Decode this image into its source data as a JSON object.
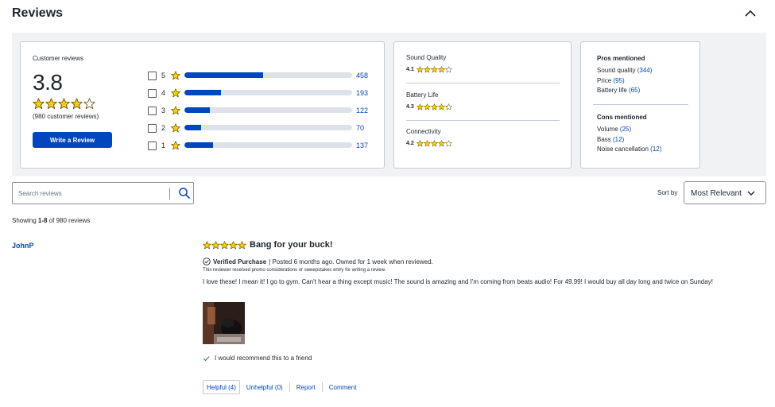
{
  "header": {
    "title": "Reviews",
    "collapse_icon": "chevron-up-icon"
  },
  "summary": {
    "label": "Customer reviews",
    "average": "3.8",
    "average_rating": 3.8,
    "count_text": "(980 customer reviews)",
    "write_button": "Write a Review",
    "histogram": [
      {
        "stars": "5",
        "count": "458",
        "fraction": 0.47
      },
      {
        "stars": "4",
        "count": "193",
        "fraction": 0.22
      },
      {
        "stars": "3",
        "count": "122",
        "fraction": 0.15
      },
      {
        "stars": "2",
        "count": "70",
        "fraction": 0.1
      },
      {
        "stars": "1",
        "count": "137",
        "fraction": 0.17
      }
    ]
  },
  "attributes": [
    {
      "name": "Sound Quality",
      "score": "4.1",
      "rating": 4.1
    },
    {
      "name": "Battery Life",
      "score": "4.3",
      "rating": 4.3
    },
    {
      "name": "Connectivity",
      "score": "4.2",
      "rating": 4.2
    }
  ],
  "pros": {
    "title": "Pros mentioned",
    "items": [
      {
        "label": "Sound quality",
        "count": "(344)"
      },
      {
        "label": "Price",
        "count": "(95)"
      },
      {
        "label": "Battery life",
        "count": "(65)"
      }
    ]
  },
  "cons": {
    "title": "Cons mentioned",
    "items": [
      {
        "label": "Volume",
        "count": "(25)"
      },
      {
        "label": "Bass",
        "count": "(12)"
      },
      {
        "label": "Noise cancellation",
        "count": "(12)"
      }
    ]
  },
  "search": {
    "placeholder": "Search reviews",
    "value": "",
    "icon": "search-icon"
  },
  "sort": {
    "label": "Sort by",
    "value": "Most Relevant"
  },
  "showing": {
    "prefix": "Showing ",
    "range": "1-8",
    "suffix": " of 980 reviews"
  },
  "review": {
    "author": "JohnP",
    "rating": 5,
    "title": "Bang for your buck!",
    "verified": "Verified Purchase",
    "posted": " | Posted 6 months ago. Owned for 1 week when reviewed.",
    "promo": "This reviewer received promo considerations or sweepstakes entry for writing a review.",
    "body": "I love these! I mean it! I go to gym. Can't hear a thing except music! The sound is amazing and I'm coming from beats audio! For 49.99! I would buy all day long and  twice on Sunday!",
    "recommend": "I would recommend this to a friend",
    "helpful": "Helpful (4)",
    "unhelpful": "Unhelpful (0)",
    "report": "Report",
    "comment": "Comment"
  },
  "colors": {
    "accent": "#0046be",
    "star": "#ffce00",
    "star_outline": "#5a4a00"
  }
}
